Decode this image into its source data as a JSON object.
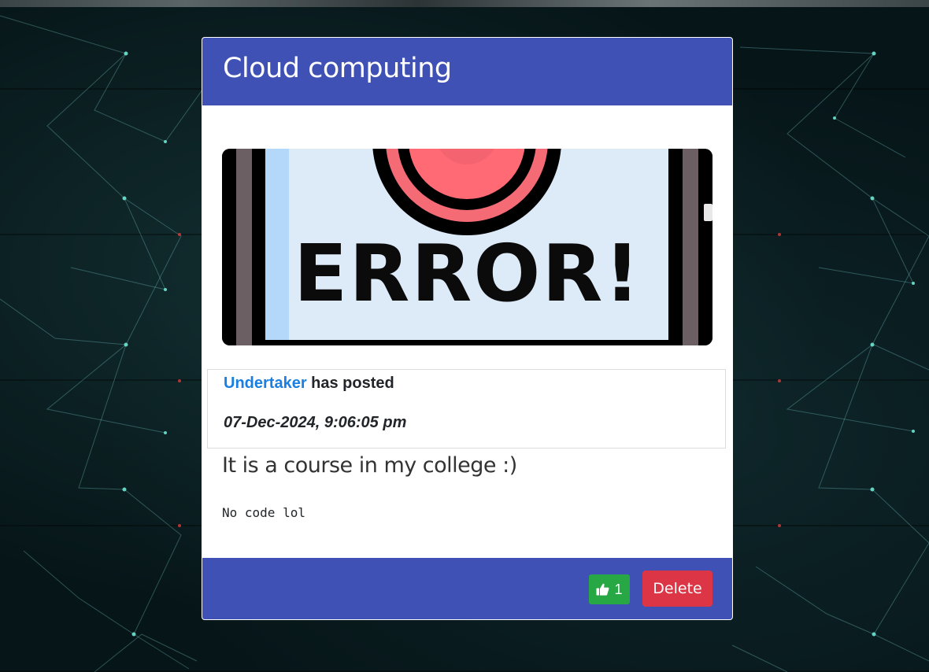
{
  "post": {
    "title": "Cloud computing",
    "image": {
      "alt_icon": "error-illustration",
      "text": "ERROR!"
    },
    "author": "Undertaker",
    "posted_label": " has posted",
    "date": "07-Dec-2024, 9:06:05 pm",
    "heading": "It is a course in my college :)",
    "code": "No code lol"
  },
  "actions": {
    "like_icon": "thumbs-up-icon",
    "like_count": "1",
    "delete_label": "Delete"
  },
  "colors": {
    "header": "#3f51b5",
    "footer": "#3f51b5",
    "author_link": "#1a7fe0",
    "like_button": "#28a745",
    "delete_button": "#dc3545",
    "background": "#061518"
  }
}
